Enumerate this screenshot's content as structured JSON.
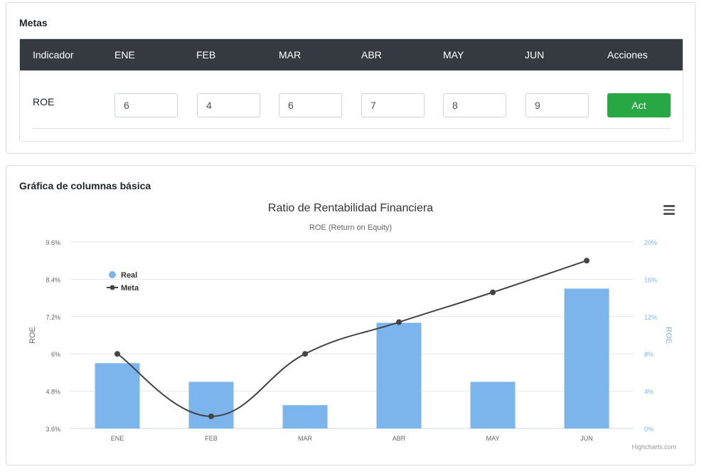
{
  "goals": {
    "title": "Metas",
    "headers": [
      "Indicador",
      "ENE",
      "FEB",
      "MAR",
      "ABR",
      "MAY",
      "JUN",
      "Acciones"
    ],
    "row_label": "ROE",
    "values": [
      "6",
      "4",
      "6",
      "7",
      "8",
      "9"
    ],
    "action_label": "Act"
  },
  "chart_card": {
    "title": "Gráfica de columnas básica",
    "menu_icon": "hamburger-menu-icon"
  },
  "colors": {
    "header_bg": "#343a40",
    "button": "#28a745",
    "bar": "#7cb5ec",
    "line": "#434348",
    "right_axis": "#7cb5ec"
  },
  "chart_data": {
    "type": "bar",
    "title": "Ratio de Rentabilidad Financiera",
    "subtitle": "ROE (Return on Equity)",
    "categories": [
      "ENE",
      "FEB",
      "MAR",
      "ABR",
      "MAY",
      "JUN"
    ],
    "ylabel": "ROE",
    "y2label": "ROE",
    "ylim": [
      3.6,
      9.6
    ],
    "yticks": [
      "3.6%",
      "4.8%",
      "6%",
      "7.2%",
      "8.4%",
      "9.6%"
    ],
    "yticks_values": [
      3.6,
      4.8,
      6,
      7.2,
      8.4,
      9.6
    ],
    "y2lim": [
      0,
      20
    ],
    "y2ticks": [
      "0%",
      "4%",
      "8%",
      "12%",
      "16%",
      "20%"
    ],
    "y2ticks_values": [
      0,
      4,
      8,
      12,
      16,
      20
    ],
    "series": [
      {
        "name": "Real",
        "type": "column",
        "axis": "left",
        "values": [
          5.7,
          5.1,
          4.35,
          7.0,
          5.1,
          8.1
        ]
      },
      {
        "name": "Meta",
        "type": "spline",
        "axis": "right",
        "values": [
          8,
          1.3,
          8,
          11.4,
          14.6,
          18
        ]
      }
    ],
    "legend_position": "top-left",
    "credits": "Highcharts.com",
    "grid": true
  }
}
